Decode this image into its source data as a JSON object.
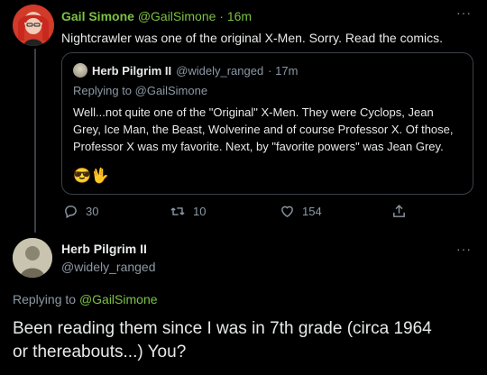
{
  "colors": {
    "accent": "#7cc142",
    "muted": "#8b98a5",
    "text": "#e7e9ea",
    "border": "#3b4148"
  },
  "tweet1": {
    "author_name": "Gail Simone",
    "author_handle": "@GailSimone",
    "time": "· 16m",
    "more_icon": "more-dots-icon",
    "text": "Nightcrawler was one of the original X-Men. Sorry. Read the comics.",
    "quote": {
      "author_name": "Herb Pilgrim II",
      "author_handle": "@widely_ranged",
      "time": "· 17m",
      "replying_prefix": "Replying to",
      "replying_handle": "@GailSimone",
      "line1": "Well...not quite one of the \"Original\" X-Men. They were Cyclops, Jean",
      "line2": "Grey, Ice Man, the Beast, Wolverine and of course Professor X. Of those,",
      "line3": "Professor X was my favorite. Next, by \"favorite powers\" was Jean Grey.",
      "emoji": "😎🖖"
    },
    "actions": {
      "replies": "30",
      "retweets": "10",
      "likes": "154"
    }
  },
  "tweet2": {
    "author_name": "Herb Pilgrim II",
    "author_handle": "@widely_ranged",
    "more_icon": "more-dots-icon",
    "replying_prefix": "Replying to",
    "replying_handle": "@GailSimone",
    "line1": "Been reading them since I was in 7th grade (circa 1964",
    "line2": "or thereabouts...) You?"
  }
}
